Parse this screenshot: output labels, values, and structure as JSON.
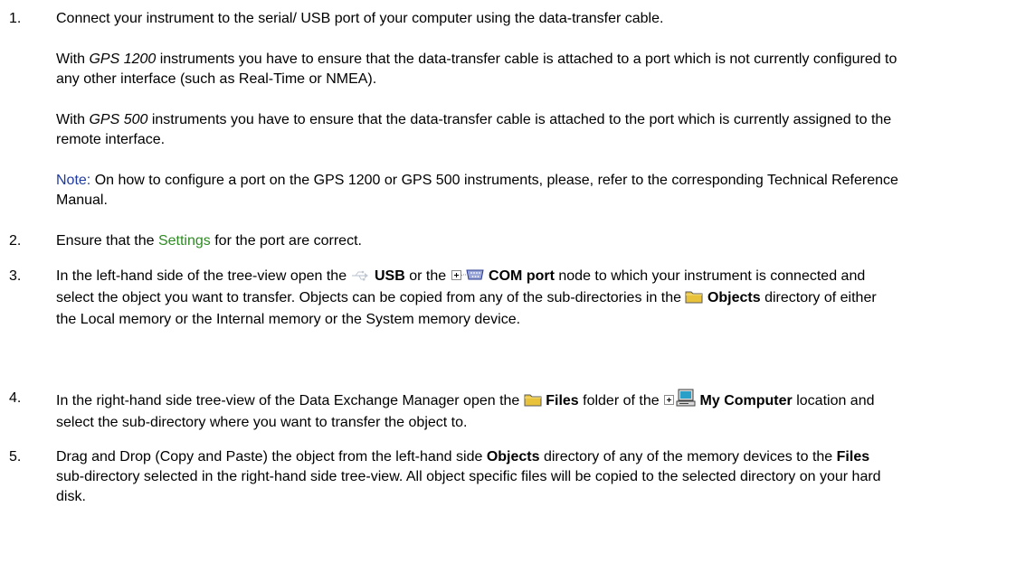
{
  "steps": [
    {
      "num": "1.",
      "text": "Connect your instrument to the serial/ USB port of your computer using the data-transfer cable.",
      "para1": {
        "pre": "With ",
        "em": "GPS 1200",
        "post": " instruments you have to ensure that the data-transfer cable is attached to a port which is not currently configured to any other interface (such as Real-Time or NMEA)."
      },
      "para2": {
        "pre": "With ",
        "em": "GPS 500",
        "post": " instruments you have to ensure that the data-transfer cable is attached to the port which is currently assigned to the remote interface."
      },
      "note": {
        "label": "Note:",
        "text": " On how to configure a port on the GPS 1200 or GPS 500 instruments, please, refer to the corresponding Technical Reference Manual."
      }
    },
    {
      "num": "2.",
      "pre": "Ensure that the ",
      "link": "Settings",
      "post": " for the port are correct."
    },
    {
      "num": "3.",
      "t1": "In the left-hand side of the tree-view open the ",
      "b1": "USB",
      "t2": " or the ",
      "b2": "COM port",
      "t3": " node to which your instrument is connected and select the object you want to transfer. Objects can be copied from any of the sub-directories in the ",
      "b3": "Objects",
      "t4": " directory of either the Local memory or the Internal memory or the System memory device."
    },
    {
      "num": "4.",
      "t1": "In the right-hand side tree-view of the Data Exchange Manager open the ",
      "b1": "Files",
      "t2": " folder of the ",
      "b2": "My Computer",
      "t3": " location and select the sub-directory where you want to transfer the object to."
    },
    {
      "num": "5.",
      "t1": "Drag and Drop (Copy and Paste) the object from the left-hand side ",
      "b1": "Objects",
      "t2": " directory of any of the memory devices to the ",
      "b2": "Files",
      "t3": " sub-directory selected in the right-hand side tree-view. All object specific files will be copied to the selected directory on your hard disk."
    }
  ],
  "icons": {
    "usb": "usb-icon",
    "expand": "tree-expand-icon",
    "com_port": "com-port-icon",
    "folder": "folder-icon",
    "my_computer": "my-computer-icon"
  },
  "colors": {
    "note": "#1f3aa0",
    "link": "#2e8b22",
    "folder": "#e8c23a"
  }
}
